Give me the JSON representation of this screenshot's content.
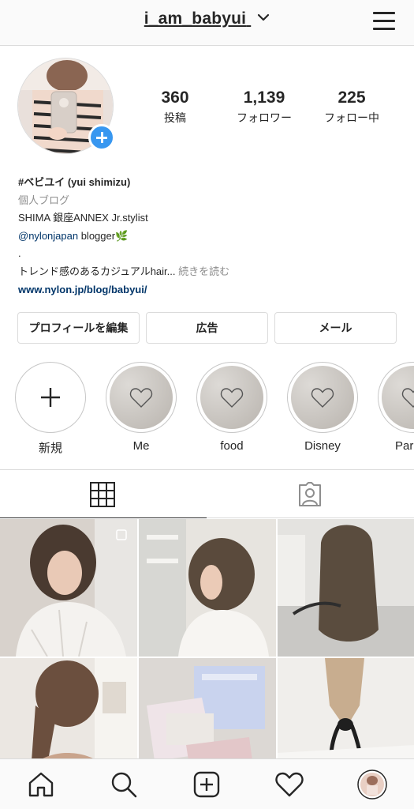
{
  "header": {
    "username": "i_am_babyui"
  },
  "profile": {
    "stats": [
      {
        "value": "360",
        "label": "投稿"
      },
      {
        "value": "1,139",
        "label": "フォロワー"
      },
      {
        "value": "225",
        "label": "フォロー中"
      }
    ],
    "bio": {
      "name": "#ベビユイ (yui shimizu)",
      "category": "個人ブログ",
      "line1": "SHIMA 銀座ANNEX Jr.stylist",
      "mention": "@nylonjapan",
      "mention_suffix": " blogger🌿",
      "dot": ".",
      "line3": "トレンド感のあるカジュアルhair... ",
      "more": "続きを読む",
      "link": "www.nylon.jp/blog/babyui/"
    }
  },
  "buttons": {
    "edit": "プロフィールを編集",
    "ads": "広告",
    "mail": "メール"
  },
  "highlights": [
    {
      "label": "新規"
    },
    {
      "label": "Me"
    },
    {
      "label": "food"
    },
    {
      "label": "Disney"
    },
    {
      "label": "Par"
    }
  ],
  "colors": {
    "accent": "#3897f0",
    "link": "#003569",
    "border": "#dbdbdb",
    "muted": "#8e8e8e"
  }
}
